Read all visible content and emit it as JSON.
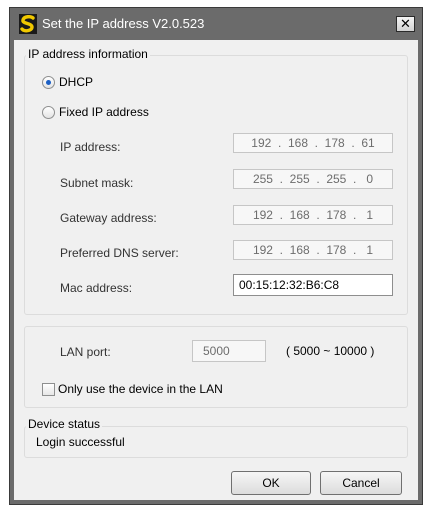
{
  "window": {
    "title": "Set the IP address  V2.0.523",
    "app_icon": "s-logo-icon",
    "close_label": "✕"
  },
  "ip_group": {
    "title": "IP address information",
    "dhcp_label": "DHCP",
    "fixed_label": "Fixed IP address",
    "selected": "DHCP",
    "ip_label": "IP address:",
    "ip_value": "192  .  168  .  178  .  61",
    "subnet_label": "Subnet mask:",
    "subnet_value": "255  .  255  .  255  .   0",
    "gateway_label": "Gateway address:",
    "gateway_value": "192  .  168  .  178  .   1",
    "dns_label": "Preferred DNS server:",
    "dns_value": "192  .  168  .  178  .   1",
    "mac_label": "Mac address:",
    "mac_value": "00:15:12:32:B6:C8"
  },
  "lan_group": {
    "port_label": "LAN port:",
    "port_value": "5000",
    "port_range": "( 5000 ~ 10000 )",
    "lan_only_label": "Only use the device in the LAN",
    "lan_only_checked": false
  },
  "status_group": {
    "title": "Device status",
    "status_text": "Login successful"
  },
  "buttons": {
    "ok_label": "OK",
    "cancel_label": "Cancel"
  }
}
